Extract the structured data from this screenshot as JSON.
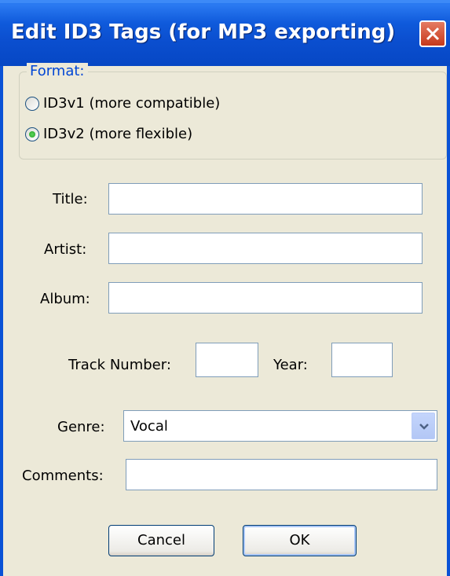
{
  "window": {
    "title": "Edit ID3 Tags (for MP3 exporting)",
    "close_icon": "close-icon"
  },
  "format": {
    "legend": "Format:",
    "options": [
      {
        "label": "ID3v1 (more compatible)",
        "selected": false
      },
      {
        "label": "ID3v2 (more flexible)",
        "selected": true
      }
    ]
  },
  "fields": {
    "title": {
      "label": "Title:",
      "value": ""
    },
    "artist": {
      "label": "Artist:",
      "value": ""
    },
    "album": {
      "label": "Album:",
      "value": ""
    },
    "track_number": {
      "label": "Track Number:",
      "value": ""
    },
    "year": {
      "label": "Year:",
      "value": ""
    },
    "genre": {
      "label": "Genre:",
      "value": "Vocal"
    },
    "comments": {
      "label": "Comments:",
      "value": ""
    }
  },
  "buttons": {
    "cancel": "Cancel",
    "ok": "OK"
  },
  "colors": {
    "titlebar": "#0A52D6",
    "dialog_bg": "#ECE9D8",
    "legend_text": "#0046D5",
    "close_button": "#D5492A"
  }
}
